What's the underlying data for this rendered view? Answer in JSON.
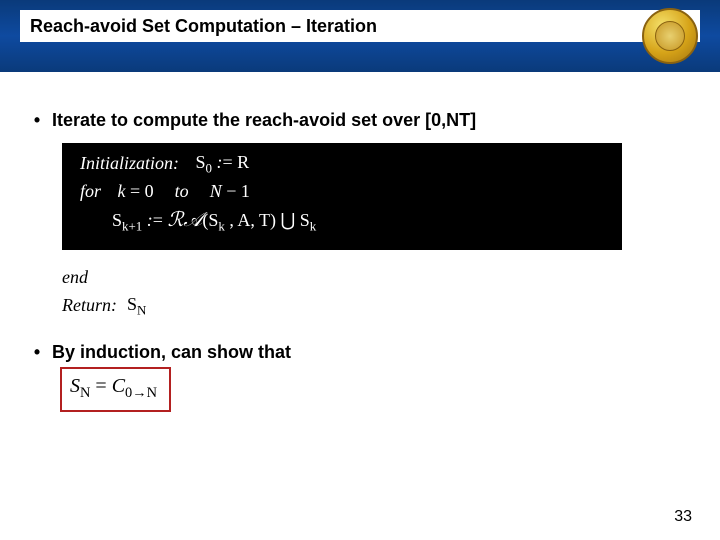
{
  "header": {
    "title": "Reach-avoid Set Computation – Iteration"
  },
  "bullet1": {
    "text": "Iterate to compute the reach-avoid set over [0,NT]"
  },
  "algo": {
    "init_label": "Initialization:",
    "init_formula": "S₀ := R",
    "for_label": "for",
    "for_from": "k = 0",
    "to_label": "to",
    "for_to": "N − 1",
    "step_formula": "Sₖ₊₁ := 𝓡𝓐(Sₖ , A, T) ∪ Sₖ",
    "end_label": "end",
    "return_label": "Return:",
    "return_value": "S_N"
  },
  "bullet2": {
    "text": "By induction, can show that"
  },
  "boxed_formula": "S_N = C₀→N",
  "page_number": "33"
}
